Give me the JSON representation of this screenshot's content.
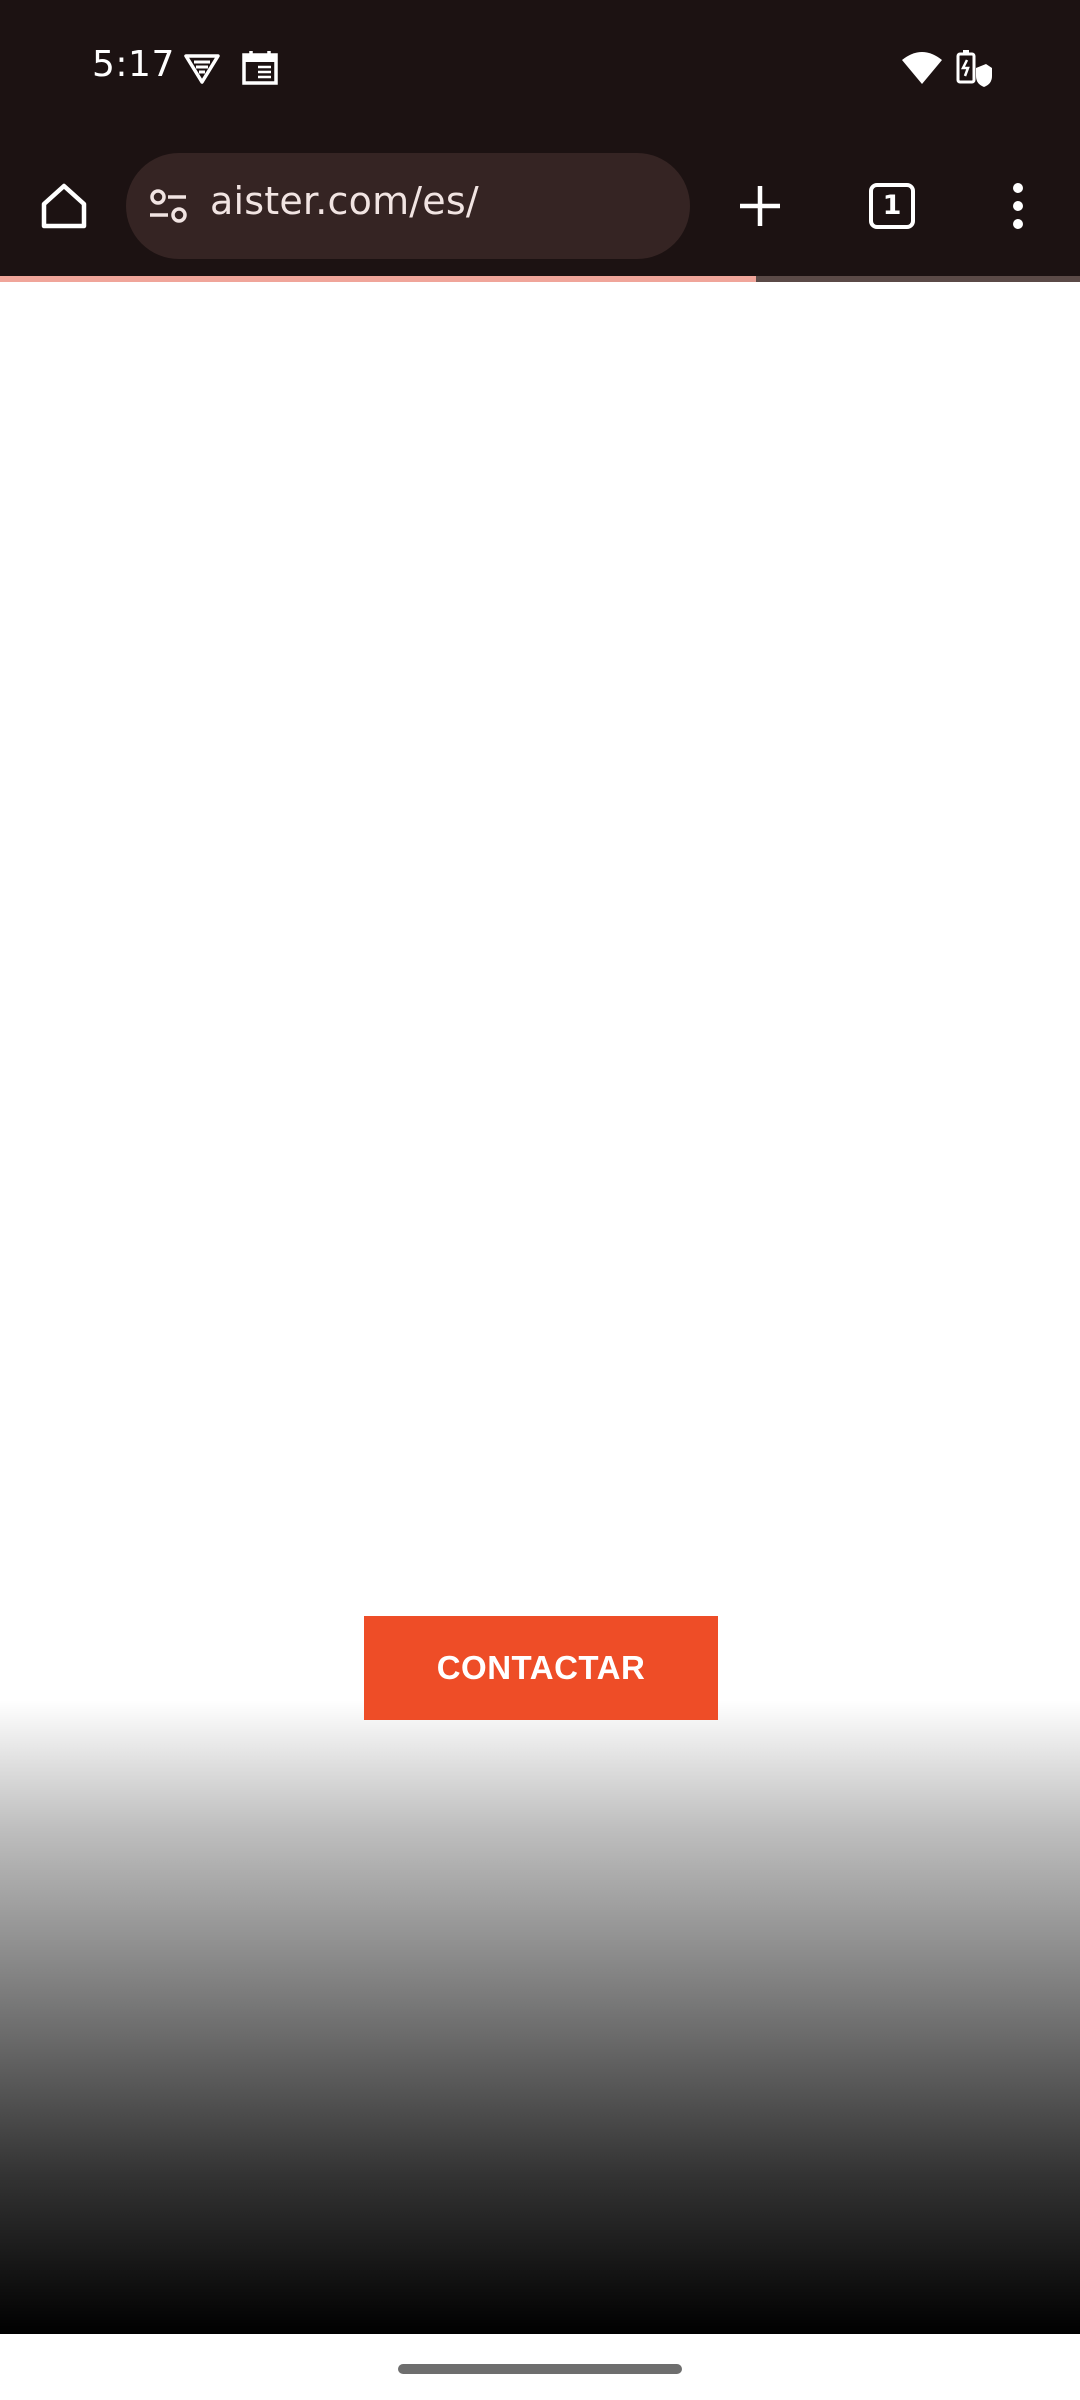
{
  "status_bar": {
    "time": "5:17",
    "icons_left": [
      "vpn-shield-icon",
      "calendar-icon"
    ],
    "icons_right": [
      "wifi-icon",
      "battery-icon"
    ]
  },
  "browser": {
    "url": "aister.com/es/",
    "tab_count": "1",
    "load_progress": 0.7,
    "icons": [
      "home-icon",
      "site-settings-icon",
      "new-tab-icon",
      "tab-switcher-icon",
      "more-menu-icon"
    ]
  },
  "page": {
    "cta_label": "CONTACTAR",
    "cta_color": "#ee4d27"
  },
  "colors": {
    "chrome_bg": "#1c1212",
    "omnibox_bg": "#352423",
    "progress": "#f0a59a"
  }
}
